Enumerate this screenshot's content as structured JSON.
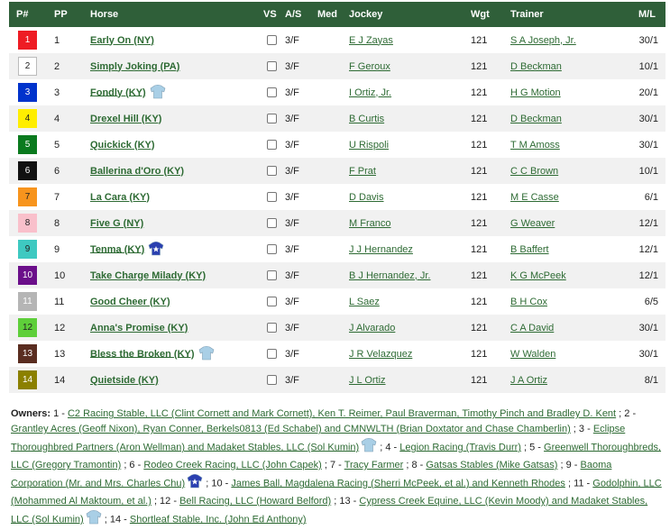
{
  "table": {
    "headers": {
      "program": "P#",
      "pp": "PP",
      "horse": "Horse",
      "vs": "VS",
      "as": "A/S",
      "med": "Med",
      "jockey": "Jockey",
      "wgt": "Wgt",
      "trainer": "Trainer",
      "ml": "M/L"
    },
    "rows": [
      {
        "program": "1",
        "bg": "#ee1c24",
        "fg": "#ffffff",
        "outline": false,
        "pp": "1",
        "horse": "Early On (NY)",
        "silk": null,
        "as": "3/F",
        "med": "",
        "jockey": "E J Zayas",
        "wgt": "121",
        "trainer": "S A Joseph, Jr.",
        "ml": "30/1"
      },
      {
        "program": "2",
        "bg": "#ffffff",
        "fg": "#222222",
        "outline": true,
        "pp": "2",
        "horse": "Simply Joking (PA)",
        "silk": null,
        "as": "3/F",
        "med": "",
        "jockey": "F Geroux",
        "wgt": "121",
        "trainer": "D Beckman",
        "ml": "10/1"
      },
      {
        "program": "3",
        "bg": "#0033cc",
        "fg": "#ffffff",
        "outline": false,
        "pp": "3",
        "horse": "Fondly (KY)",
        "silk": "generic-light",
        "as": "3/F",
        "med": "",
        "jockey": "I Ortiz, Jr.",
        "wgt": "121",
        "trainer": "H G Motion",
        "ml": "20/1"
      },
      {
        "program": "4",
        "bg": "#ffee00",
        "fg": "#222222",
        "outline": false,
        "pp": "4",
        "horse": "Drexel Hill (KY)",
        "silk": null,
        "as": "3/F",
        "med": "",
        "jockey": "B Curtis",
        "wgt": "121",
        "trainer": "D Beckman",
        "ml": "30/1"
      },
      {
        "program": "5",
        "bg": "#0a7a1e",
        "fg": "#ffffff",
        "outline": false,
        "pp": "5",
        "horse": "Quickick (KY)",
        "silk": null,
        "as": "3/F",
        "med": "",
        "jockey": "U Rispoli",
        "wgt": "121",
        "trainer": "T M Amoss",
        "ml": "30/1"
      },
      {
        "program": "6",
        "bg": "#111111",
        "fg": "#ffffff",
        "outline": false,
        "pp": "6",
        "horse": "Ballerina d'Oro (KY)",
        "silk": null,
        "as": "3/F",
        "med": "",
        "jockey": "F Prat",
        "wgt": "121",
        "trainer": "C C Brown",
        "ml": "10/1"
      },
      {
        "program": "7",
        "bg": "#f7941d",
        "fg": "#222222",
        "outline": false,
        "pp": "7",
        "horse": "La Cara (KY)",
        "silk": null,
        "as": "3/F",
        "med": "",
        "jockey": "D Davis",
        "wgt": "121",
        "trainer": "M E Casse",
        "ml": "6/1"
      },
      {
        "program": "8",
        "bg": "#f9c0cb",
        "fg": "#222222",
        "outline": false,
        "pp": "8",
        "horse": "Five G (NY)",
        "silk": null,
        "as": "3/F",
        "med": "",
        "jockey": "M Franco",
        "wgt": "121",
        "trainer": "G Weaver",
        "ml": "12/1"
      },
      {
        "program": "9",
        "bg": "#3ec9c1",
        "fg": "#222222",
        "outline": false,
        "pp": "9",
        "horse": "Tenma (KY)",
        "silk": "blue-star",
        "as": "3/F",
        "med": "",
        "jockey": "J J Hernandez",
        "wgt": "121",
        "trainer": "B Baffert",
        "ml": "12/1"
      },
      {
        "program": "10",
        "bg": "#6b0f8a",
        "fg": "#ffffff",
        "outline": false,
        "pp": "10",
        "horse": "Take Charge Milady (KY)",
        "silk": null,
        "as": "3/F",
        "med": "",
        "jockey": "B J Hernandez, Jr.",
        "wgt": "121",
        "trainer": "K G McPeek",
        "ml": "12/1"
      },
      {
        "program": "11",
        "bg": "#b5b5b5",
        "fg": "#ffffff",
        "outline": false,
        "pp": "11",
        "horse": "Good Cheer (KY)",
        "silk": null,
        "as": "3/F",
        "med": "",
        "jockey": "L Saez",
        "wgt": "121",
        "trainer": "B H Cox",
        "ml": "6/5"
      },
      {
        "program": "12",
        "bg": "#5ecf3a",
        "fg": "#222222",
        "outline": false,
        "pp": "12",
        "horse": "Anna's Promise (KY)",
        "silk": null,
        "as": "3/F",
        "med": "",
        "jockey": "J Alvarado",
        "wgt": "121",
        "trainer": "C A David",
        "ml": "30/1"
      },
      {
        "program": "13",
        "bg": "#5a2d20",
        "fg": "#ffffff",
        "outline": false,
        "pp": "13",
        "horse": "Bless the Broken (KY)",
        "silk": "generic-light",
        "as": "3/F",
        "med": "",
        "jockey": "J R Velazquez",
        "wgt": "121",
        "trainer": "W Walden",
        "ml": "30/1"
      },
      {
        "program": "14",
        "bg": "#8b8000",
        "fg": "#ffffff",
        "outline": false,
        "pp": "14",
        "horse": "Quietside (KY)",
        "silk": null,
        "as": "3/F",
        "med": "",
        "jockey": "J L Ortiz",
        "wgt": "121",
        "trainer": "J A Ortiz",
        "ml": "8/1"
      }
    ]
  },
  "owners": {
    "label": "Owners:",
    "segments": [
      {
        "t": "text",
        "v": " 1 - "
      },
      {
        "t": "link",
        "v": "C2 Racing Stable, LLC (Clint Cornett and Mark Cornett), Ken T. Reimer, Paul Braverman, Timothy Pinch and Bradley D. Kent"
      },
      {
        "t": "text",
        "v": " ; 2 - "
      },
      {
        "t": "link",
        "v": "Grantley Acres (Geoff Nixon), Ryan Conner, Berkels0813 (Ed Schabel) and CMNWLTH (Brian Doxtator and Chase Chamberlin)"
      },
      {
        "t": "text",
        "v": " ; 3 - "
      },
      {
        "t": "link",
        "v": "Eclipse Thoroughbred Partners (Aron Wellman) and Madaket Stables, LLC (Sol Kumin)"
      },
      {
        "t": "silk",
        "v": "generic-light"
      },
      {
        "t": "text",
        "v": " ; 4 - "
      },
      {
        "t": "link",
        "v": "Legion Racing (Travis Durr)"
      },
      {
        "t": "text",
        "v": " ; 5 - "
      },
      {
        "t": "link",
        "v": "Greenwell Thoroughbreds, LLC (Gregory Tramontin)"
      },
      {
        "t": "text",
        "v": " ; 6 - "
      },
      {
        "t": "link",
        "v": "Rodeo Creek Racing, LLC (John Capek)"
      },
      {
        "t": "text",
        "v": " ; 7 - "
      },
      {
        "t": "link",
        "v": "Tracy Farmer"
      },
      {
        "t": "text",
        "v": " ; 8 - "
      },
      {
        "t": "link",
        "v": "Gatsas Stables (Mike Gatsas)"
      },
      {
        "t": "text",
        "v": " ; 9 - "
      },
      {
        "t": "link",
        "v": "Baoma Corporation (Mr. and Mrs. Charles Chu)"
      },
      {
        "t": "silk",
        "v": "blue-star"
      },
      {
        "t": "text",
        "v": " ; 10 - "
      },
      {
        "t": "link",
        "v": "James Ball, Magdalena Racing (Sherri McPeek, et al.) and Kenneth Rhodes"
      },
      {
        "t": "text",
        "v": " ; 11 - "
      },
      {
        "t": "link",
        "v": "Godolphin, LLC (Mohammed Al Maktoum, et al.)"
      },
      {
        "t": "text",
        "v": " ; 12 - "
      },
      {
        "t": "link",
        "v": "Bell Racing, LLC (Howard Belford)"
      },
      {
        "t": "text",
        "v": " ; 13 - "
      },
      {
        "t": "link",
        "v": "Cypress Creek Equine, LLC (Kevin Moody) and Madaket Stables, LLC (Sol Kumin)"
      },
      {
        "t": "silk",
        "v": "generic-light"
      },
      {
        "t": "text",
        "v": " ; 14 - "
      },
      {
        "t": "link",
        "v": "Shortleaf Stable, Inc. (John Ed Anthony)"
      }
    ]
  },
  "colors": {
    "header_bg": "#2f5f39",
    "link": "#2e6b34",
    "row_alt": "#f1f1f1",
    "silk_light": "#a9cfe6",
    "silk_blue": "#2a3fb0"
  }
}
